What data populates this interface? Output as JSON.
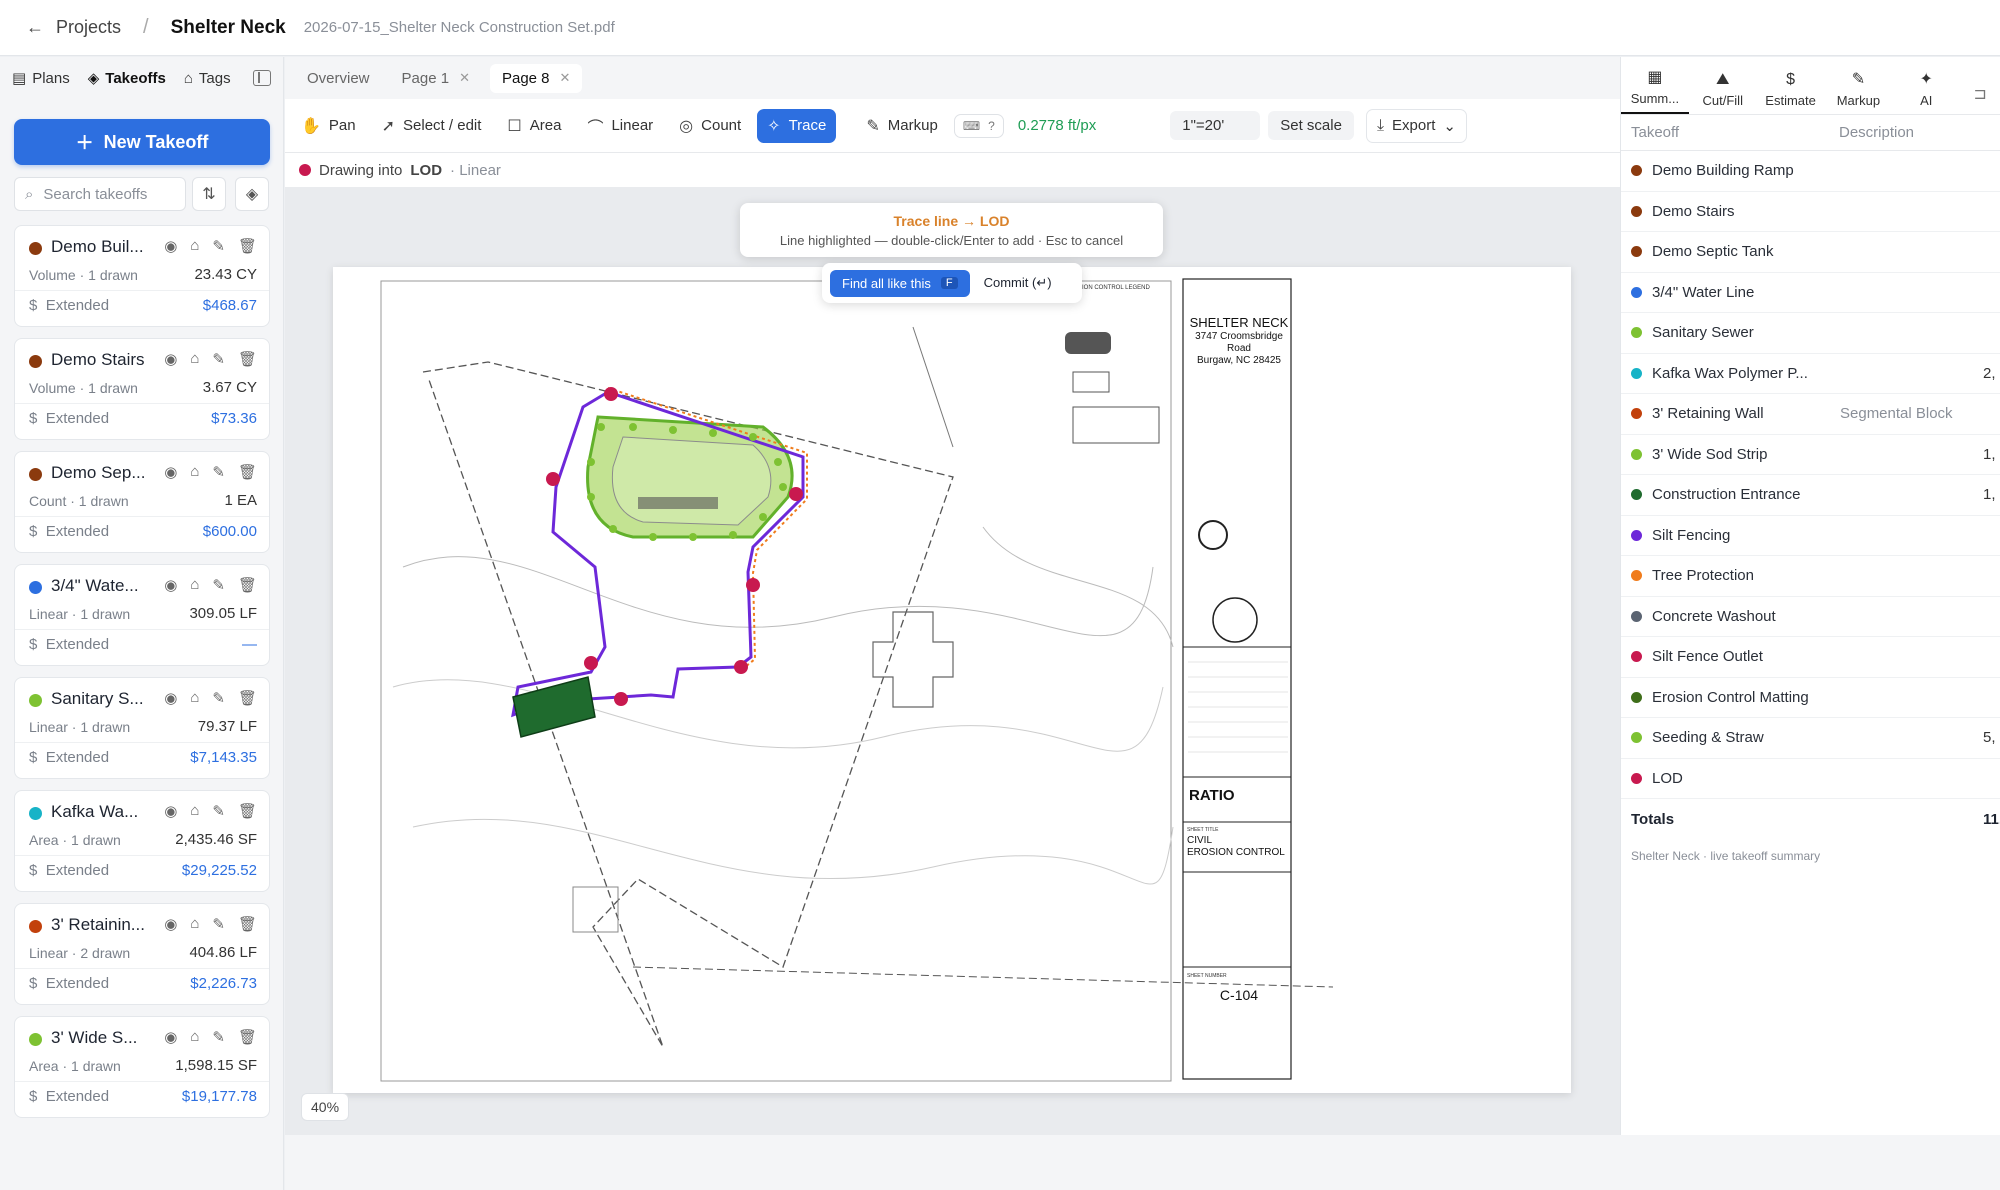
{
  "header": {
    "back_label": "Projects",
    "project": "Shelter Neck",
    "file": "2026-07-15_Shelter Neck Construction Set.pdf"
  },
  "left_tabs": [
    "Plans",
    "Takeoffs",
    "Tags"
  ],
  "new_takeoff": "New Takeoff",
  "search_placeholder": "Search takeoffs",
  "cards": [
    {
      "name": "Demo Buil...",
      "color": "#8b3a0e",
      "sub": "Volume · 1 drawn",
      "qty": "23.43 CY",
      "ext_label": "Extended",
      "ext": "$468.67"
    },
    {
      "name": "Demo Stairs",
      "color": "#8b3a0e",
      "sub": "Volume · 1 drawn",
      "qty": "3.67 CY",
      "ext_label": "Extended",
      "ext": "$73.36"
    },
    {
      "name": "Demo Sep...",
      "color": "#8b3a0e",
      "sub": "Count · 1 drawn",
      "qty": "1 EA",
      "ext_label": "Extended",
      "ext": "$600.00"
    },
    {
      "name": "3/4\" Wate...",
      "color": "#2d6fe0",
      "sub": "Linear · 1 drawn",
      "qty": "309.05 LF",
      "ext_label": "Extended",
      "ext": "—"
    },
    {
      "name": "Sanitary S...",
      "color": "#7ec232",
      "sub": "Linear · 1 drawn",
      "qty": "79.37 LF",
      "ext_label": "Extended",
      "ext": "$7,143.35"
    },
    {
      "name": "Kafka Wa...",
      "color": "#17b3c7",
      "sub": "Area · 1 drawn",
      "qty": "2,435.46 SF",
      "ext_label": "Extended",
      "ext": "$29,225.52"
    },
    {
      "name": "3' Retainin...",
      "color": "#c2410c",
      "sub": "Linear · 2 drawn",
      "qty": "404.86 LF",
      "ext_label": "Extended",
      "ext": "$2,226.73"
    },
    {
      "name": "3' Wide S...",
      "color": "#7ec232",
      "sub": "Area · 1 drawn",
      "qty": "1,598.15 SF",
      "ext_label": "Extended",
      "ext": "$19,177.78"
    }
  ],
  "page_tabs": [
    "Overview",
    "Page 1",
    "Page 8"
  ],
  "tools": [
    "Pan",
    "Select / edit",
    "Area",
    "Linear",
    "Count",
    "Trace",
    "Markup"
  ],
  "scale": "0.2778 ft/px",
  "scale_ratio": "1\"=20'",
  "set_scale": "Set scale",
  "export": "Export",
  "drawing_into": {
    "prefix": "Drawing into",
    "target": "LOD",
    "mode": "· Linear"
  },
  "trace_popup": {
    "title": "Trace line → LOD",
    "hint": "Line highlighted — double-click/Enter to add · Esc to cancel",
    "find_all": "Find all like this",
    "find_key": "F",
    "commit": "Commit (↵)"
  },
  "zoom": "40%",
  "sheet": {
    "project": "SHELTER NECK",
    "address1": "3747 Croomsbridge",
    "address2": "Road",
    "address3": "Burgaw, NC  28425",
    "title_label": "SHEET TITLE",
    "title1": "CIVIL",
    "title2": "EROSION CONTROL",
    "number_label": "SHEET NUMBER",
    "number": "C-104",
    "firm": "RATIO",
    "legend_title": "EROSION CONTROL LEGEND"
  },
  "right_tabs": [
    "Summ...",
    "Cut/Fill",
    "Estimate",
    "Markup",
    "AI"
  ],
  "right_head": {
    "takeoff": "Takeoff",
    "description": "Description"
  },
  "rows": [
    {
      "name": "Demo Building Ramp",
      "color": "#8b3a0e",
      "desc": "",
      "val": ""
    },
    {
      "name": "Demo Stairs",
      "color": "#8b3a0e",
      "desc": "",
      "val": ""
    },
    {
      "name": "Demo Septic Tank",
      "color": "#8b3a0e",
      "desc": "",
      "val": ""
    },
    {
      "name": "3/4\" Water Line",
      "color": "#2d6fe0",
      "desc": "",
      "val": ""
    },
    {
      "name": "Sanitary Sewer",
      "color": "#7ec232",
      "desc": "",
      "val": ""
    },
    {
      "name": "Kafka Wax Polymer P...",
      "color": "#17b3c7",
      "desc": "",
      "val": "2,"
    },
    {
      "name": "3' Retaining Wall",
      "color": "#c2410c",
      "desc": "Segmental Block",
      "val": ""
    },
    {
      "name": "3' Wide Sod Strip",
      "color": "#7ec232",
      "desc": "",
      "val": "1,"
    },
    {
      "name": "Construction Entrance",
      "color": "#1f6b2e",
      "desc": "",
      "val": "1,"
    },
    {
      "name": "Silt Fencing",
      "color": "#6d28d9",
      "desc": "",
      "val": ""
    },
    {
      "name": "Tree Protection",
      "color": "#f07c1c",
      "desc": "",
      "val": ""
    },
    {
      "name": "Concrete Washout",
      "color": "#5b6472",
      "desc": "",
      "val": ""
    },
    {
      "name": "Silt Fence Outlet",
      "color": "#c8194f",
      "desc": "",
      "val": ""
    },
    {
      "name": "Erosion Control Matting",
      "color": "#3f6e1a",
      "desc": "",
      "val": ""
    },
    {
      "name": "Seeding & Straw",
      "color": "#7ec232",
      "desc": "",
      "val": "5,"
    },
    {
      "name": "LOD",
      "color": "#c8194f",
      "desc": "",
      "val": ""
    }
  ],
  "totals": {
    "label": "Totals",
    "value": "11,"
  },
  "footer": "Shelter Neck · live takeoff summary"
}
